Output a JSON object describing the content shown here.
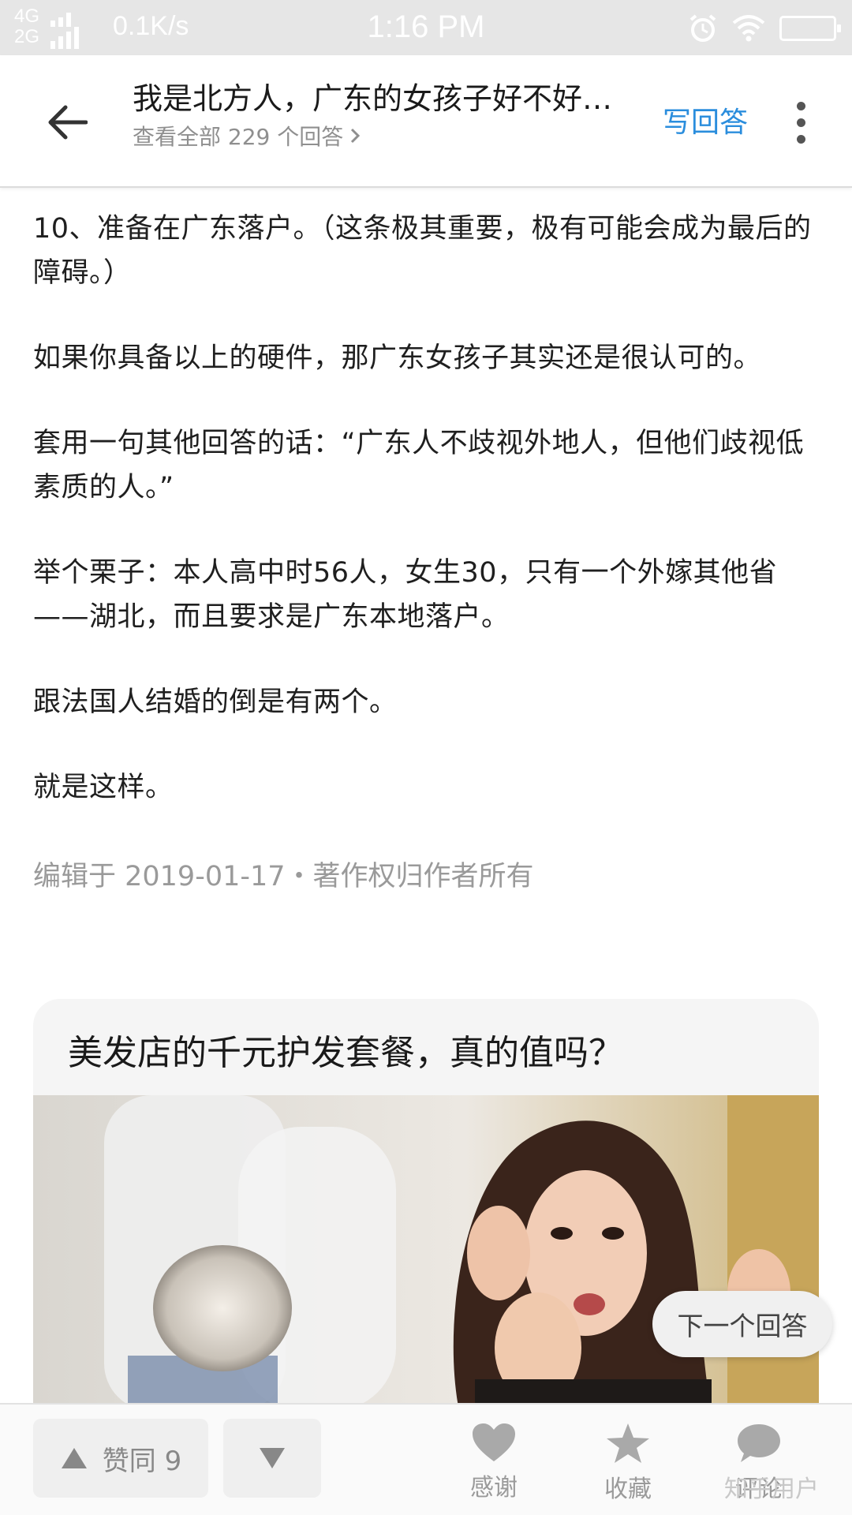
{
  "status_bar": {
    "network_top": "4G",
    "network_bottom": "2G",
    "speed": "0.1K/s",
    "time": "1:16 PM",
    "icons": [
      "alarm-icon",
      "wifi-icon",
      "battery-icon"
    ]
  },
  "header": {
    "question_title": "我是北方人，广东的女孩子好不好…",
    "view_all": "查看全部 229 个回答",
    "write_answer": "写回答",
    "accent_color": "#2a8ddd"
  },
  "article": {
    "paragraphs": [
      "10、准备在广东落户。（这条极其重要，极有可能会成为最后的障碍。）",
      "如果你具备以上的硬件，那广东女孩子其实还是很认可的。",
      "套用一句其他回答的话：“广东人不歧视外地人，但他们歧视低素质的人。”",
      "举个栗子：本人高中时56人，女生30，只有一个外嫁其他省——湖北，而且要求是广东本地落户。",
      "跟法国人结婚的倒是有两个。",
      "就是这样。"
    ],
    "meta": "编辑于 2019-01-17・著作权归作者所有"
  },
  "ad": {
    "title": "美发店的千元护发套餐，真的值吗？"
  },
  "next_answer": "下一个回答",
  "bottom_bar": {
    "upvote_label": "赞同 9",
    "thanks_label": "感谢",
    "favorite_label": "收藏",
    "comment_label": "评论",
    "watermark": "知乎用户"
  }
}
